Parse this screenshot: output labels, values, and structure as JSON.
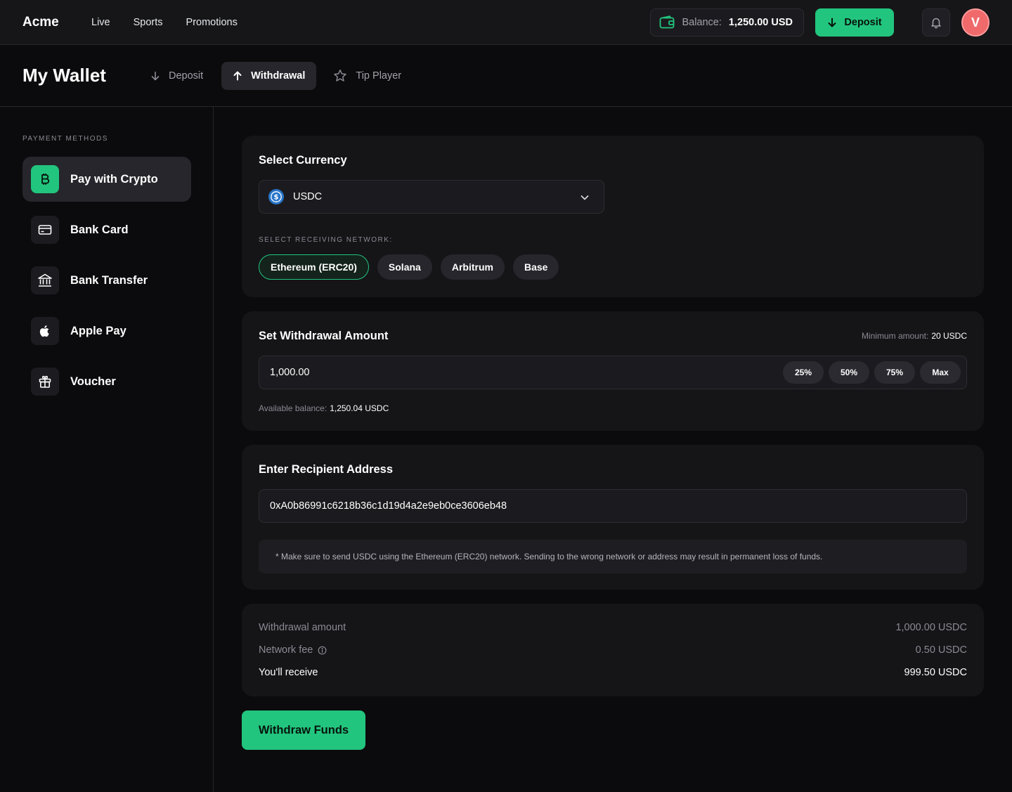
{
  "app": {
    "logo": "Acme"
  },
  "nav": {
    "items": [
      "Live",
      "Sports",
      "Promotions"
    ]
  },
  "header": {
    "balance_label": "Balance:",
    "balance_value": "1,250.00 USD",
    "deposit_label": "Deposit",
    "avatar_initial": "V"
  },
  "page": {
    "title": "My Wallet",
    "tabs": [
      "Deposit",
      "Withdrawal",
      "Tip Player"
    ],
    "active_tab": "Withdrawal"
  },
  "sidebar": {
    "title": "PAYMENT METHODS",
    "items": [
      {
        "label": "Pay with Crypto",
        "icon": "bitcoin-icon",
        "active": true
      },
      {
        "label": "Bank Card",
        "icon": "credit-card-icon"
      },
      {
        "label": "Bank Transfer",
        "icon": "bank-icon"
      },
      {
        "label": "Apple Pay",
        "icon": "apple-icon"
      },
      {
        "label": "Voucher",
        "icon": "gift-icon"
      }
    ]
  },
  "currency": {
    "title": "Select Currency",
    "selected": "USDC",
    "network_label": "SELECT RECEIVING NETWORK:",
    "networks": [
      "Ethereum (ERC20)",
      "Solana",
      "Arbitrum",
      "Base"
    ],
    "selected_network": "Ethereum (ERC20)"
  },
  "amount": {
    "title": "Set Withdrawal Amount",
    "min_label": "Minimum amount:",
    "min_value": "20 USDC",
    "value": "1,000.00",
    "presets": [
      "25%",
      "50%",
      "75%",
      "Max"
    ],
    "available_label": "Available balance:",
    "available_value": "1,250.04 USDC"
  },
  "recipient": {
    "title": "Enter Recipient Address",
    "address": "0xA0b86991c6218b36c1d19d4a2e9eb0ce3606eb48",
    "notice": "* Make sure to send USDC using the Ethereum (ERC20) network. Sending to the wrong network or address may result in permanent loss of funds."
  },
  "summary": {
    "withdrawal_label": "Withdrawal amount",
    "withdrawal_value": "1,000.00 USDC",
    "fee_label": "Network fee",
    "fee_value": "0.50 USDC",
    "receive_label": "You'll receive",
    "receive_value": "999.50 USDC"
  },
  "cta": {
    "label": "Withdraw Funds"
  },
  "colors": {
    "accent": "#22c57e",
    "background": "#0b0b0d",
    "card": "#151518",
    "avatar": "#f0696b",
    "usdc": "#2775ca"
  }
}
